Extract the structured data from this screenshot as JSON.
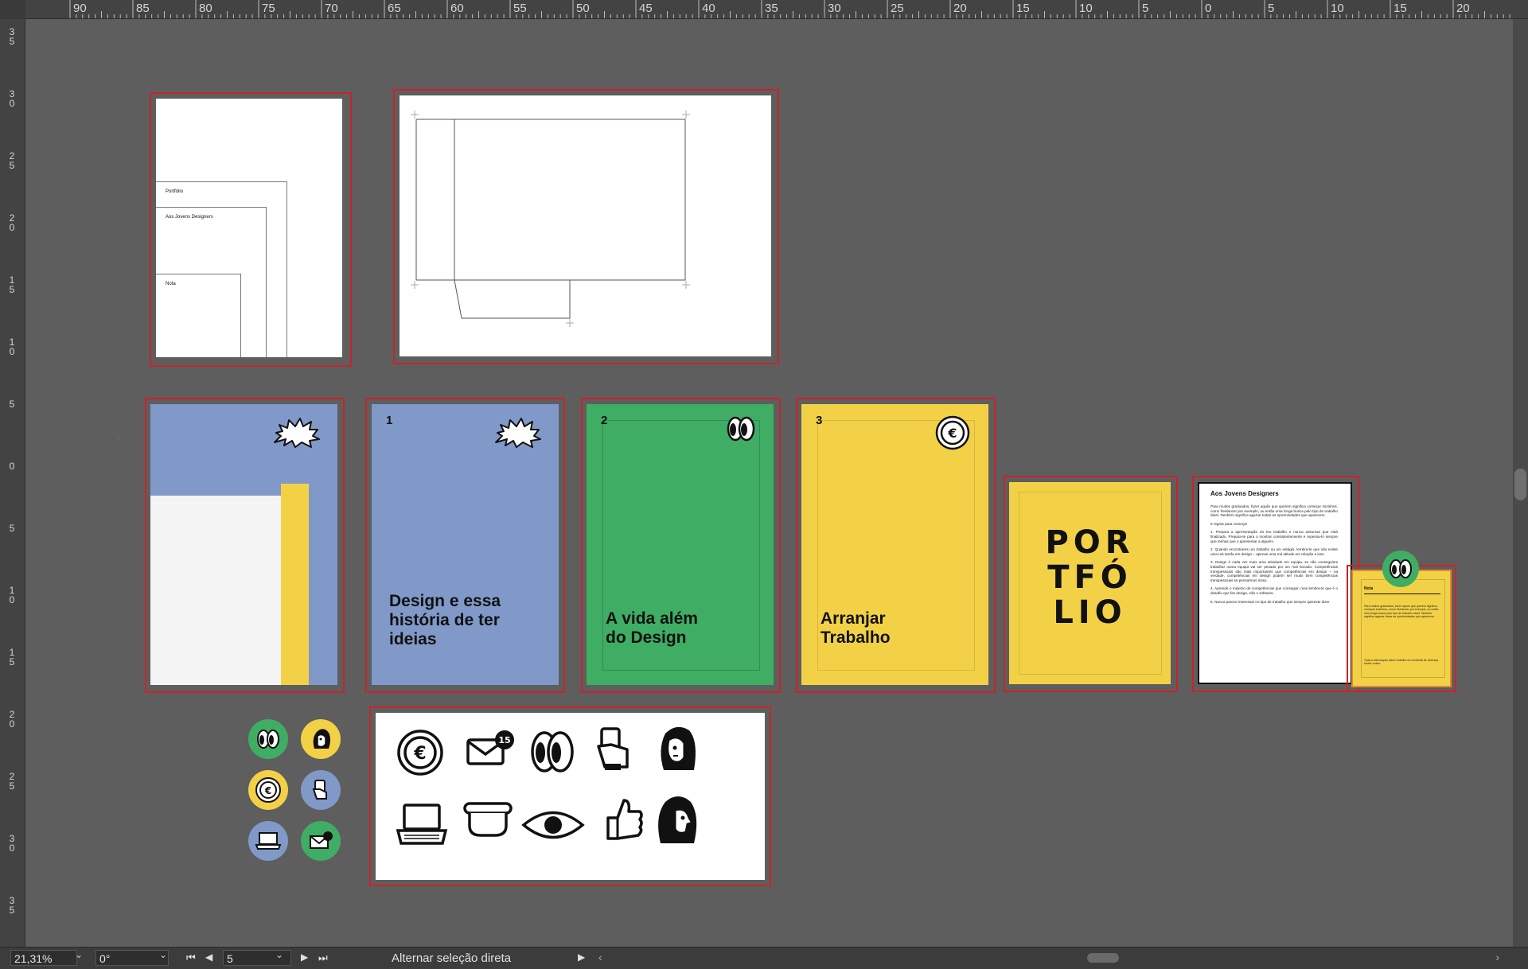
{
  "ruler_top": {
    "labels": [
      "90",
      "85",
      "80",
      "75",
      "70",
      "65",
      "60",
      "55",
      "50",
      "45",
      "40",
      "35",
      "30",
      "25",
      "20",
      "15",
      "10",
      "5",
      "0",
      "5",
      "10",
      "15",
      "20"
    ]
  },
  "ruler_left": {
    "labels": [
      "35",
      "30",
      "25",
      "20",
      "15",
      "10",
      "5",
      "0",
      "5",
      "10",
      "15",
      "20",
      "25",
      "30",
      "35"
    ]
  },
  "artboard_a": {
    "labels": [
      "Portfólio",
      "Aos Jovens Designers",
      "Nota"
    ]
  },
  "covers": {
    "c1": {
      "number": "1",
      "title_line1": "Design e essa",
      "title_line2": "história de ter",
      "title_line3": "ideias",
      "bg": "#8199c8"
    },
    "c2": {
      "number": "2",
      "title_line1": "A vida além",
      "title_line2": "do Design",
      "bg": "#3fad64"
    },
    "c3": {
      "number": "3",
      "title_line1": "Arranjar",
      "title_line2": "Trabalho",
      "bg": "#f3d147"
    }
  },
  "portfolio": {
    "lines": [
      "POR",
      "TFÓ",
      "LIO"
    ],
    "bg": "#f3d147"
  },
  "document": {
    "title": "Aos Jovens Designers",
    "paragraphs": [
      "Para muitos graduados, fazer aquilo que querem significa começar sozinhos, como freelancer por exemplo, ou então uma longa busca pelo tipo de trabalho ideal. Também significa agarrar todas as oportunidades que aparecem.",
      "5 regras para começar",
      "1. Prepara a apresentação do teu trabalho e nunca assumas que está finalizado. Prepara-te para o mostrar consistentemente e repensa-lo sempre que tenhas que o apresentar a alguém.",
      "2. Quando encontrares um trabalho ou um estágio, lembra-te que não existe uma má tarefa em design – apenas uma má atitude em relação a isso.",
      "3. Design é cada vez mais uma atividade em equipa, se não conseguires trabalhar numa equipa vai ser pesado por um mal bocado. Competências transpessoais são mais importantes que competências em design – na verdade, competências em design podem ser muito bem competências transpessoais se pensarmos nisso.",
      "4. Aprende o máximo de competências que conseguir, mas lembra-te que é o desafio que faz design, não o software.",
      "5. Nunca parece interessar no tipo de trabalho que sempre quiseste dizer"
    ]
  },
  "note": {
    "title": "Nota",
    "body": "Para muitos graduados, fazer aquilo que querem significa começar sozinhos, como freelancer por exemplo, ou então uma longa busca pelo tipo de trabalho ideal. Também significa agarrar todas as oportunidades que aparecem.",
    "footer": "Toda a informação sobre trabalho foi recolhida de diversas fontes online."
  },
  "icon_sheet": {
    "row1": [
      "euro-coin-icon",
      "envelope-badge-icon",
      "eyes-icon",
      "hand-phone-icon",
      "woman-face-icon"
    ],
    "row2": [
      "laptop-icon",
      "mug-icon",
      "eye-icon",
      "thumbs-up-icon",
      "woman-profile-icon"
    ],
    "badge": "15"
  },
  "colors": {
    "blue": "#8199c8",
    "green": "#3fad64",
    "yellow": "#f3d147",
    "artboard_border": "#c8242a"
  },
  "status_bar": {
    "zoom": "21,31%",
    "rotation": "0°",
    "page": "5",
    "tool_status": "Alternar seleção direta"
  }
}
